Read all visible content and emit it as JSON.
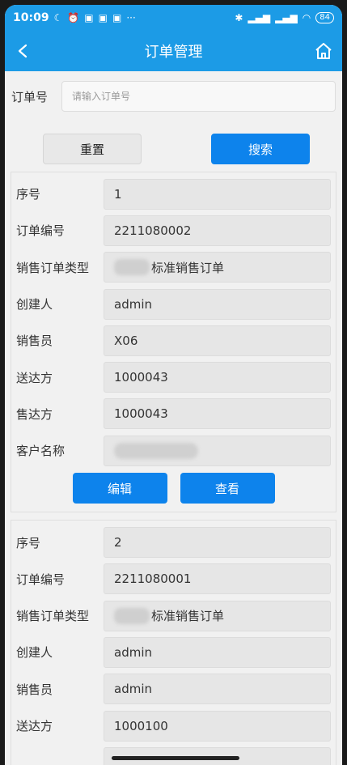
{
  "status": {
    "time": "10:09",
    "battery": "84"
  },
  "header": {
    "title": "订单管理"
  },
  "search": {
    "label": "订单号",
    "placeholder": "请输入订单号",
    "value": ""
  },
  "buttons": {
    "reset": "重置",
    "search": "搜索"
  },
  "orders": [
    {
      "fields": [
        {
          "label": "序号",
          "value": "1"
        },
        {
          "label": "订单编号",
          "value": "2211080002"
        },
        {
          "label": "销售订单类型",
          "value": "标准销售订单"
        },
        {
          "label": "创建人",
          "value": "admin"
        },
        {
          "label": "销售员",
          "value": "X06"
        },
        {
          "label": "送达方",
          "value": "1000043"
        },
        {
          "label": "售达方",
          "value": "1000043"
        },
        {
          "label": "客户名称",
          "value": ""
        }
      ],
      "edit_label": "编辑",
      "view_label": "查看"
    },
    {
      "fields": [
        {
          "label": "序号",
          "value": "2"
        },
        {
          "label": "订单编号",
          "value": "2211080001"
        },
        {
          "label": "销售订单类型",
          "value": "标准销售订单"
        },
        {
          "label": "创建人",
          "value": "admin"
        },
        {
          "label": "销售员",
          "value": "admin"
        },
        {
          "label": "送达方",
          "value": "1000100"
        }
      ]
    }
  ]
}
